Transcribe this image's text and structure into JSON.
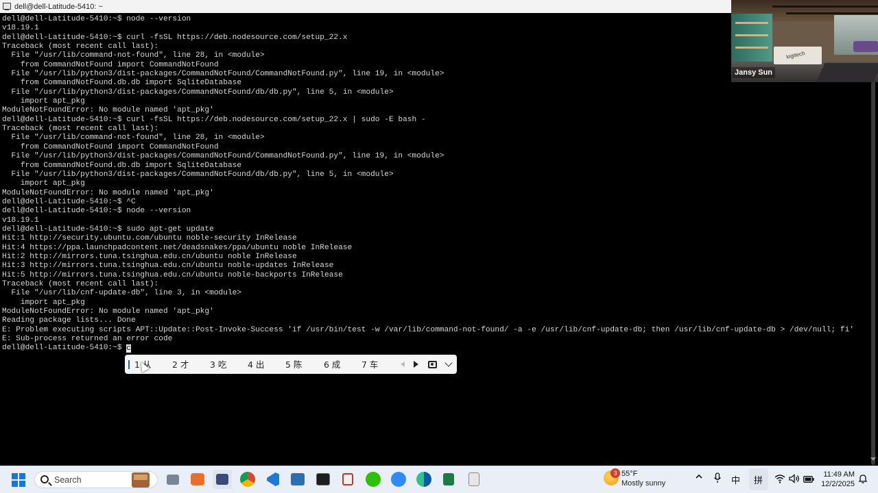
{
  "window": {
    "title": "dell@dell-Latitude-5410: ~"
  },
  "terminal": {
    "lines": [
      "dell@dell-Latitude-5410:~$ node --version",
      "v18.19.1",
      "dell@dell-Latitude-5410:~$ curl -fsSL https://deb.nodesource.com/setup_22.x",
      "Traceback (most recent call last):",
      "  File \"/usr/lib/command-not-found\", line 28, in <module>",
      "    from CommandNotFound import CommandNotFound",
      "  File \"/usr/lib/python3/dist-packages/CommandNotFound/CommandNotFound.py\", line 19, in <module>",
      "    from CommandNotFound.db.db import SqliteDatabase",
      "  File \"/usr/lib/python3/dist-packages/CommandNotFound/db/db.py\", line 5, in <module>",
      "    import apt_pkg",
      "ModuleNotFoundError: No module named 'apt_pkg'",
      "dell@dell-Latitude-5410:~$ curl -fsSL https://deb.nodesource.com/setup_22.x | sudo -E bash -",
      "Traceback (most recent call last):",
      "  File \"/usr/lib/command-not-found\", line 28, in <module>",
      "    from CommandNotFound import CommandNotFound",
      "  File \"/usr/lib/python3/dist-packages/CommandNotFound/CommandNotFound.py\", line 19, in <module>",
      "    from CommandNotFound.db.db import SqliteDatabase",
      "  File \"/usr/lib/python3/dist-packages/CommandNotFound/db/db.py\", line 5, in <module>",
      "    import apt_pkg",
      "ModuleNotFoundError: No module named 'apt_pkg'",
      "dell@dell-Latitude-5410:~$ ^C",
      "dell@dell-Latitude-5410:~$ node --version",
      "v18.19.1",
      "dell@dell-Latitude-5410:~$ sudo apt-get update",
      "Hit:1 http://security.ubuntu.com/ubuntu noble-security InRelease",
      "Hit:4 https://ppa.launchpadcontent.net/deadsnakes/ppa/ubuntu noble InRelease",
      "Hit:2 http://mirrors.tuna.tsinghua.edu.cn/ubuntu noble InRelease",
      "Hit:3 http://mirrors.tuna.tsinghua.edu.cn/ubuntu noble-updates InRelease",
      "Hit:5 http://mirrors.tuna.tsinghua.edu.cn/ubuntu noble-backports InRelease",
      "Traceback (most recent call last):",
      "  File \"/usr/lib/cnf-update-db\", line 3, in <module>",
      "    import apt_pkg",
      "ModuleNotFoundError: No module named 'apt_pkg'",
      "Reading package lists... Done",
      "E: Problem executing scripts APT::Update::Post-Invoke-Success 'if /usr/bin/test -w /var/lib/command-not-found/ -a -e /usr/lib/cnf-update-db; then /usr/lib/cnf-update-db > /dev/null; fi'",
      "E: Sub-process returned an error code"
    ],
    "prompt": "dell@dell-Latitude-5410:~$ ",
    "input": "c"
  },
  "video": {
    "participant_name": "Jansy Sun",
    "logo_text": "logitech"
  },
  "ime": {
    "candidates": [
      "1 从",
      "2 才",
      "3 吃",
      "4 出",
      "5 陈",
      "6 成",
      "7 车"
    ],
    "icons": [
      "prev-page-icon",
      "next-page-icon",
      "skin-icon",
      "expand-chevron-icon"
    ]
  },
  "taskbar": {
    "search_label": "Search",
    "apps": [
      "file-explorer-icon",
      "slides-app-icon",
      "terminal-app-icon",
      "chrome-icon",
      "vscode-icon",
      "network-tool-icon",
      "console-icon",
      "snipping-tool-icon",
      "wechat-icon",
      "zoom-icon",
      "edge-icon",
      "excel-like-icon",
      "calculator-icon"
    ],
    "active_app": "terminal-app-icon"
  },
  "tray": {
    "weather_badge": "3",
    "weather_temp": "55°F",
    "weather_condition": "Mostly sunny",
    "ime_lang": "中",
    "ime_mode": "拼",
    "time": "11:49 AM",
    "date": "12/2/2025"
  },
  "colors": {
    "accent": "#1677d8",
    "terminal_bg": "#000000",
    "terminal_fg": "#d6d6d6",
    "taskbar_bg": "#e9eef7"
  }
}
